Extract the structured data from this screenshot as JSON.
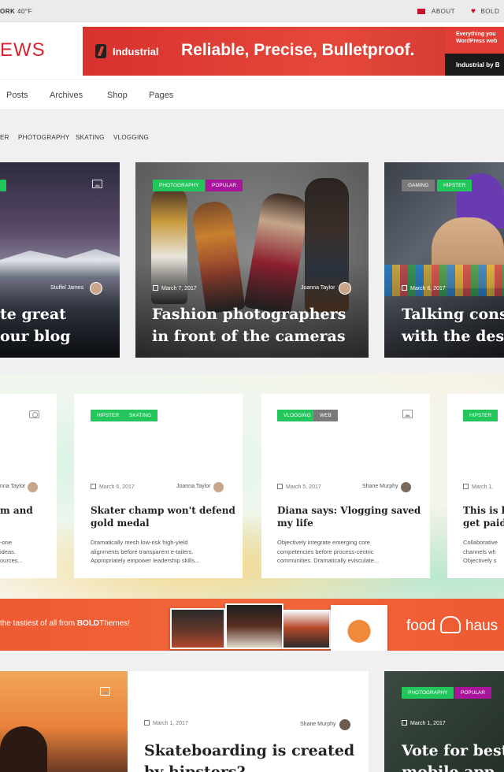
{
  "topbar": {
    "weather_city": "ORK",
    "weather_temp": "40°F",
    "about": "ABOUT",
    "bold": "BOLD"
  },
  "header": {
    "logo": "EWS",
    "banner": {
      "brand": "Industrial",
      "slogan": "Reliable, Precise, Bulletproof.",
      "side_line1": "Everything you",
      "side_line2": "WordPress web",
      "side_brand": "Industrial by B"
    }
  },
  "nav": [
    "Posts",
    "Archives",
    "Shop",
    "Pages"
  ],
  "categories": [
    "ER",
    "PHOTOGRAPHY",
    "SKATING",
    "VLOGGING"
  ],
  "featured": [
    {
      "tags": [],
      "author": "Stuffel James",
      "title_line1": "te great",
      "title_line2": "our blog"
    },
    {
      "tags": [
        "PHOTOGRAPHY",
        "POPULAR"
      ],
      "date": "March 7, 2017",
      "author": "Joanna Taylor",
      "title_line1": "Fashion photographers",
      "title_line2": "in front of the cameras"
    },
    {
      "tags": [
        "GAMING",
        "HIPSTER"
      ],
      "date": "March 6, 2017",
      "title_line1": "Talking conse",
      "title_line2": "with the desi"
    }
  ],
  "cards": [
    {
      "author": "nna Taylor",
      "title_line1": "m and",
      "excerpt": [
        "-one",
        "ideas.",
        "ources..."
      ]
    },
    {
      "tags": [
        "HIPSTER",
        "SKATING"
      ],
      "date": "March 6, 2017",
      "author": "Joanna Taylor",
      "title_line1": "Skater champ won't defend",
      "title_line2": "gold medal",
      "excerpt": [
        "Dramatically mesh low-risk high-yield",
        "alignments before transparent e-tailers.",
        "Appropriately empower leadership skills..."
      ]
    },
    {
      "tags": [
        "VLOGGING",
        "WEB"
      ],
      "date": "March 5, 2017",
      "author": "Shane Murphy",
      "title_line1": "Diana says: Vlogging saved",
      "title_line2": "my life",
      "excerpt": [
        "Objectively integrate emerging core",
        "competencies before process-centric",
        "communities. Dramatically evisculate..."
      ]
    },
    {
      "tags": [
        "HIPSTER"
      ],
      "date": "March 1,",
      "title_line1": "This is h",
      "title_line2": "get paid",
      "excerpt": [
        "Collaborative",
        "channels wh",
        "Objectively s"
      ]
    }
  ],
  "foodbanner": {
    "text_prefix": "the tastiest of all from",
    "text_brand": "BOLD",
    "text_suffix": "Themes!",
    "logo_left": "food",
    "logo_right": "haus"
  },
  "bottom": [
    {
      "date": "March 1, 2017",
      "author": "Shane Murphy",
      "title_line1": "Skateboarding is created",
      "title_line2": "by hipsters?"
    },
    {
      "tags": [
        "PHOTOGRAPHY",
        "POPULAR"
      ],
      "date": "March 1, 2017",
      "title_line1": "Vote for best",
      "title_line2": "mobile app"
    }
  ],
  "colors": {
    "accent_red": "#d5262f",
    "tag_green": "#22c65b",
    "tag_magenta": "#a8149a",
    "food_orange": "#ee5a32"
  }
}
